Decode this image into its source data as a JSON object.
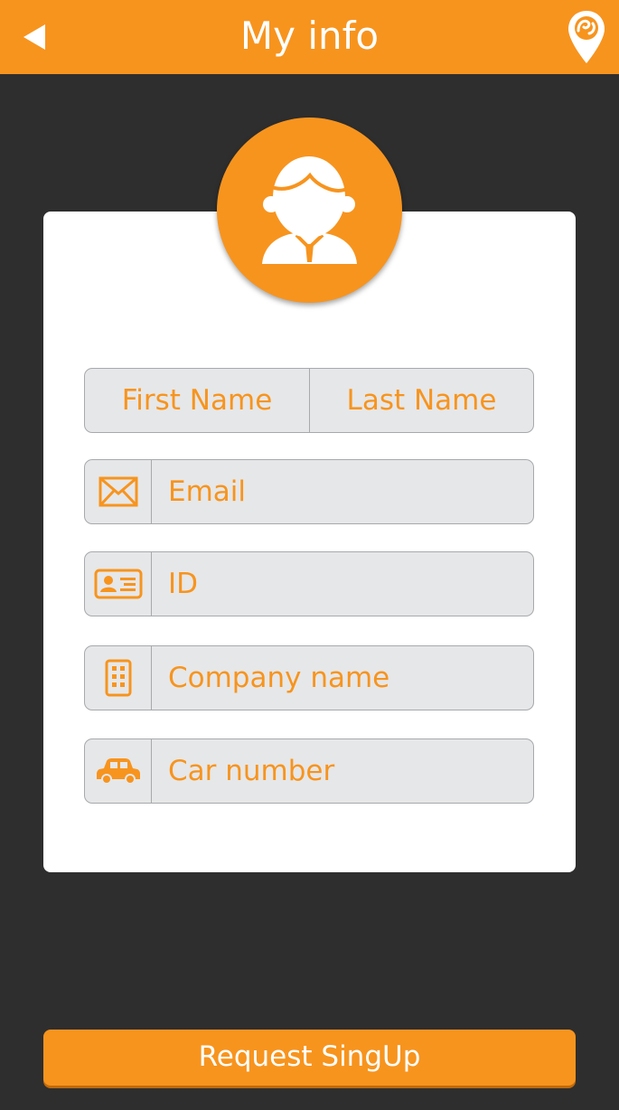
{
  "header": {
    "title": "My info",
    "back_icon": "back-arrow-icon",
    "location_icon": "map-pin-icon"
  },
  "avatar": {
    "icon": "user-avatar-icon"
  },
  "form": {
    "first_name_placeholder": "First Name",
    "last_name_placeholder": "Last Name",
    "email_placeholder": "Email",
    "id_placeholder": "ID",
    "company_placeholder": "Company name",
    "car_placeholder": "Car number"
  },
  "submit_label": "Request SingUp",
  "colors": {
    "accent": "#f7941e",
    "background": "#2e2e2e",
    "field_bg": "#e6e7e8",
    "field_border": "#a7a9ac"
  }
}
